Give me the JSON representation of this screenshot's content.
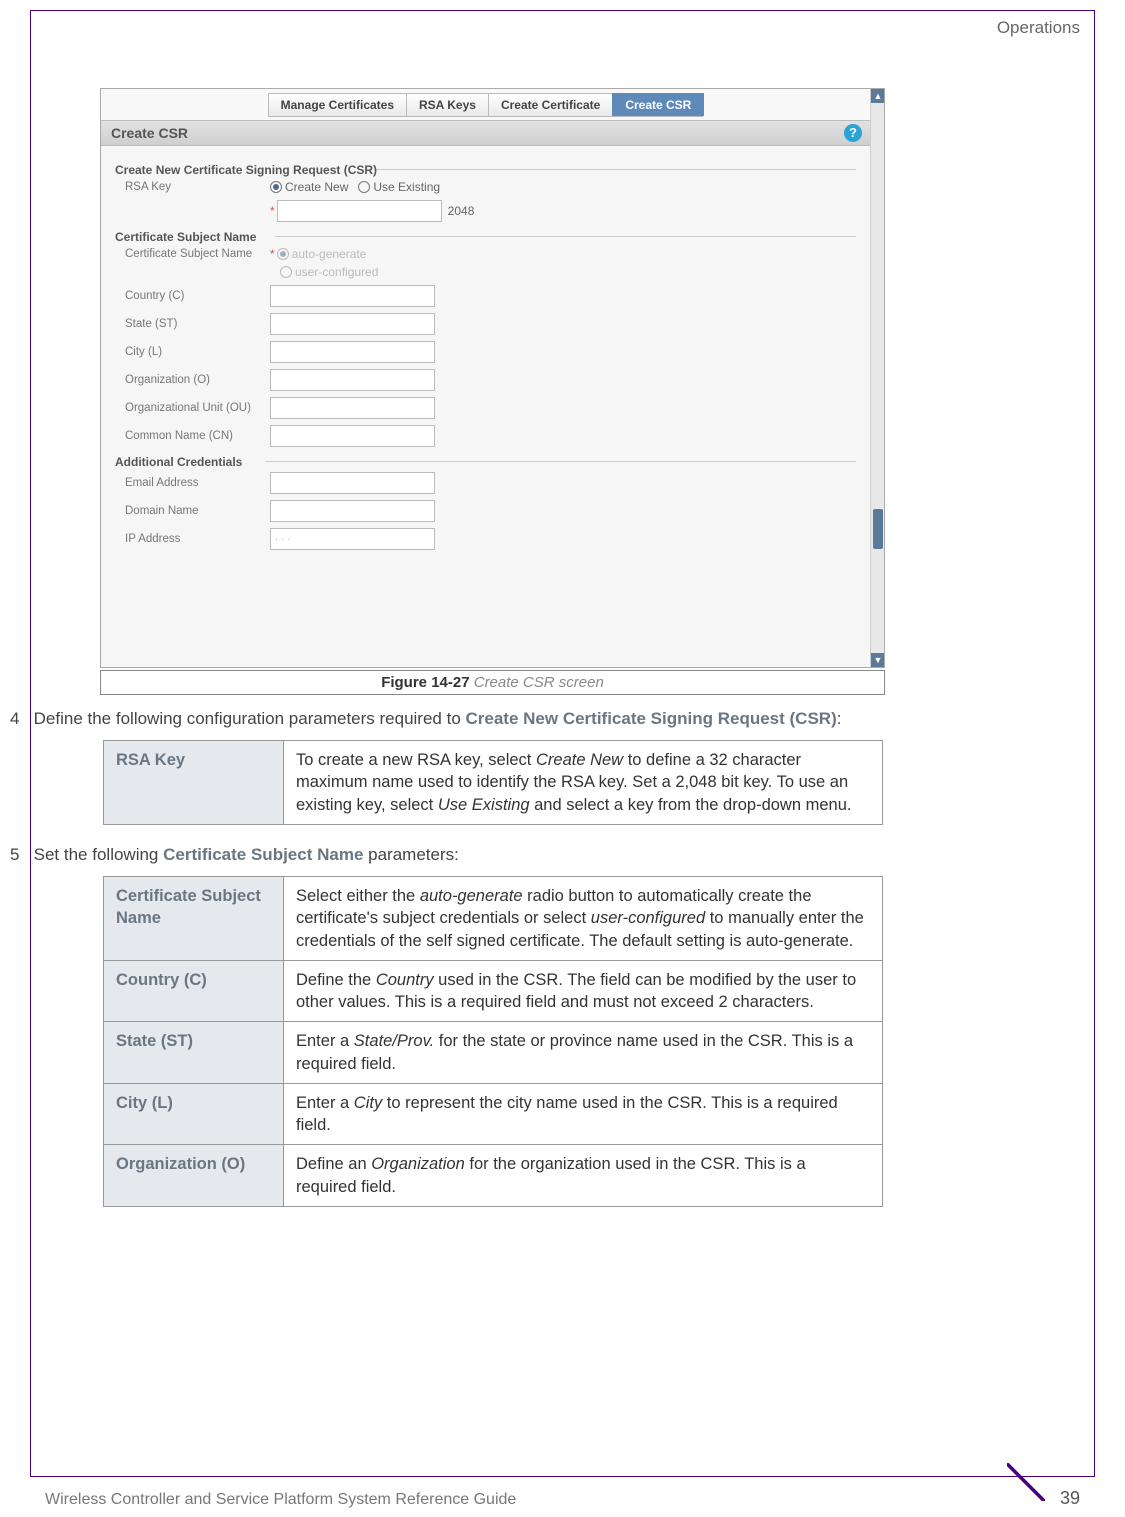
{
  "header": {
    "section": "Operations"
  },
  "screenshot": {
    "tabs": [
      "Manage Certificates",
      "RSA Keys",
      "Create Certificate",
      "Create CSR"
    ],
    "active_tab": 3,
    "panel_title": "Create CSR",
    "fieldset1": {
      "legend": "Create New Certificate Signing Request (CSR)",
      "rsa_key_label": "RSA Key",
      "radio_create": "Create New",
      "radio_existing": "Use Existing",
      "bits": "2048"
    },
    "fieldset2": {
      "legend": "Certificate Subject Name",
      "csn_label": "Certificate Subject Name",
      "radio_auto": "auto-generate",
      "radio_user": "user-configured",
      "country": "Country (C)",
      "state": "State (ST)",
      "city": "City (L)",
      "org": "Organization (O)",
      "ou": "Organizational Unit (OU)",
      "cn": "Common Name (CN)"
    },
    "fieldset3": {
      "legend": "Additional Credentials",
      "email": "Email Address",
      "domain": "Domain Name",
      "ip": "IP Address",
      "ip_placeholder": " .   .   .  "
    }
  },
  "caption": {
    "fig": "Figure 14-27",
    "title": " Create CSR screen"
  },
  "step4": {
    "num": "4",
    "text_a": "Define the following configuration parameters required to ",
    "bold": "Create New Certificate Signing Request (CSR)",
    "text_b": ":"
  },
  "table1": {
    "r1h": "RSA Key",
    "r1d_a": "To create a new RSA key, select ",
    "r1d_em1": "Create New",
    "r1d_b": " to define a 32 character maximum name used to identify the RSA key. Set a 2,048 bit key. To use an existing key, select ",
    "r1d_em2": "Use Existing",
    "r1d_c": " and select a key from the drop-down menu."
  },
  "step5": {
    "num": "5",
    "text_a": "Set the following ",
    "bold": "Certificate Subject Name",
    "text_b": " parameters:"
  },
  "table2": {
    "r1h": "Certificate Subject Name",
    "r1d_a": "Select either the ",
    "r1d_em1": "auto-generate",
    "r1d_b": " radio button to automatically create the certificate's subject credentials or select ",
    "r1d_em2": "user-configured",
    "r1d_c": " to manually enter the credentials of the self signed certificate. The default setting is auto-generate.",
    "r2h": "Country (C)",
    "r2d_a": "Define the ",
    "r2d_em": "Country",
    "r2d_b": " used in the CSR. The field can be modified by the user to other values. This is a required field and must not exceed 2 characters.",
    "r3h": "State (ST)",
    "r3d_a": "Enter a ",
    "r3d_em": "State/Prov.",
    "r3d_b": " for the state or province name used in the CSR. This is a required field.",
    "r4h": "City (L)",
    "r4d_a": "Enter a ",
    "r4d_em": "City",
    "r4d_b": " to represent the city name used in the CSR. This is a required field.",
    "r5h": "Organization (O)",
    "r5d_a": "Define an ",
    "r5d_em": "Organization",
    "r5d_b": " for the organization used in the CSR. This is a required field."
  },
  "footer": {
    "title": "Wireless Controller and Service Platform System Reference Guide",
    "page": "39"
  }
}
